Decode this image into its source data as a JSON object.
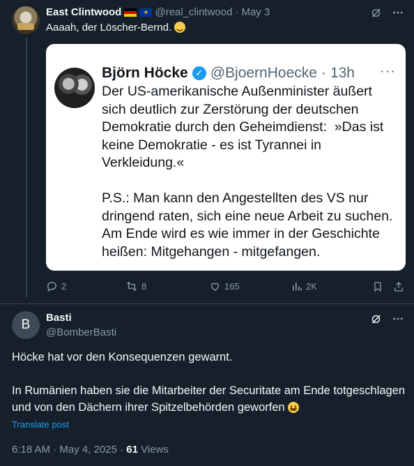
{
  "post1": {
    "author_name": "East Clintwood",
    "flags": [
      "flag-germany",
      "flag-eu"
    ],
    "handle": "@real_clintwood",
    "separator": "·",
    "date": "May 3",
    "text": "Aaaah, der Löscher-Bernd.",
    "text_emoji": "smirking-face",
    "embedded_image": {
      "author_name": "Björn Höcke",
      "handle": "@BjoernHoecke",
      "separator": "·",
      "age": "13h",
      "body": "Der US-amerikanische Außenminister äußert\nsich deutlich zur Zerstörung der deutschen\nDemokratie durch den Geheimdienst:  »Das ist\nkeine Demokratie - es ist Tyrannei in\nVerkleidung.«\n\nP.S.: Man kann den Angestellten des VS nur\ndringend raten, sich eine neue Arbeit zu suchen.\nAm Ende wird es wie immer in der Geschichte\nheißen: Mitgehangen - mitgefangen."
    },
    "actions": {
      "replies": "2",
      "reposts": "8",
      "likes": "165",
      "views": "2K"
    }
  },
  "post2": {
    "avatar_letter": "B",
    "author_name": "Basti",
    "handle": "@BomberBasti",
    "paragraph1": "Höcke hat vor den Konsequenzen gewarnt.",
    "paragraph2": "In Rumänien haben sie die Mitarbeiter der Securitate am Ende totgeschlagen und von den Dächern ihrer Spitzelbehörden geworfen",
    "paragraph2_emoji": "grinning-face",
    "translate_label": "Translate post",
    "time": "6:18 AM",
    "date": "May 4, 2025",
    "meta_separator": "·",
    "views_count": "61",
    "views_label": "Views"
  },
  "colors": {
    "background": "#15202b",
    "text_primary": "#f7f9f9",
    "text_muted": "#8b98a5",
    "accent": "#1d9bf0",
    "divider": "#38444d"
  }
}
